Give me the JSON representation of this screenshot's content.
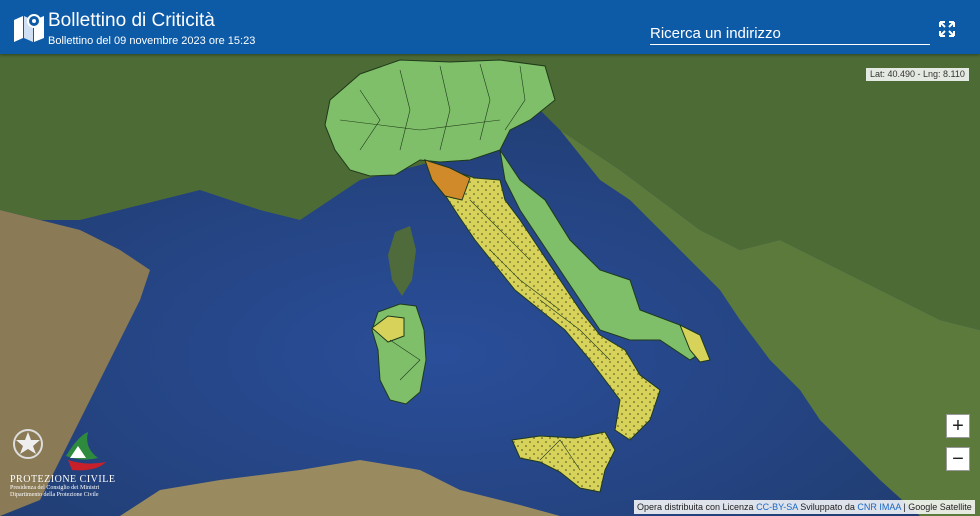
{
  "header": {
    "title": "Bollettino di Criticità",
    "subtitle": "Bollettino del 09 novembre 2023 ore 15:23"
  },
  "search": {
    "placeholder": "Ricerca un indirizzo"
  },
  "coords": {
    "text": "Lat: 40.490 - Lng: 8.110"
  },
  "zoom": {
    "in_label": "+",
    "out_label": "−"
  },
  "attribution": {
    "prefix": "Opera distribuita con Licenza",
    "license": "CC-BY-SA",
    "mid": "Sviluppato da",
    "developer": "CNR IMAA",
    "suffix": "| Google Satellite"
  },
  "logo": {
    "name": "PROTEZIONE CIVILE",
    "line1": "Presidenza del Consiglio dei Ministri",
    "line2": "Dipartimento della Protezione Civile"
  },
  "colors": {
    "header_bg": "#0d5aa7",
    "sea": "#2c4f7c",
    "alert_green": "#7fbf6a",
    "alert_yellow": "#d6d25a",
    "alert_orange": "#d08a2a"
  }
}
